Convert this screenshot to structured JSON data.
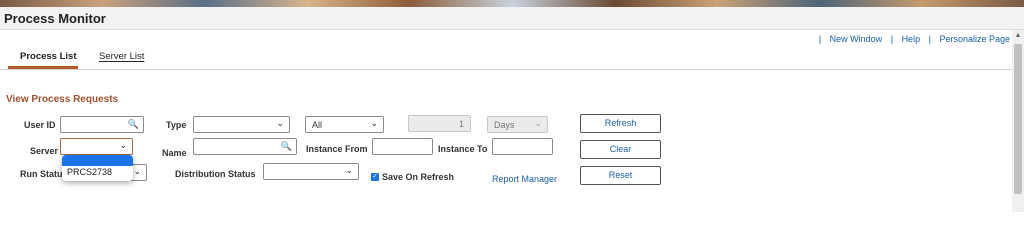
{
  "header": {
    "title": "Process Monitor"
  },
  "toplinks": {
    "new_window": "New Window",
    "help": "Help",
    "personalize": "Personalize Page"
  },
  "tabs": [
    {
      "label": "Process List",
      "active": true
    },
    {
      "label": "Server List",
      "active": false
    }
  ],
  "section_title": "View Process Requests",
  "form": {
    "user_id_label": "User ID",
    "user_id_value": "",
    "type_label": "Type",
    "type_value": "",
    "last_value": "All",
    "number_value": "1",
    "unit_value": "Days",
    "server_label": "Server",
    "server_value": "",
    "name_label": "Name",
    "name_value": "",
    "instance_from_label": "Instance From",
    "instance_from_value": "",
    "instance_to_label": "Instance To",
    "instance_to_value": "",
    "run_status_label": "Run Status",
    "distribution_status_label": "Distribution Status",
    "distribution_status_value": "",
    "save_on_refresh_label": "Save On Refresh",
    "save_on_refresh_checked": true
  },
  "buttons": {
    "refresh": "Refresh",
    "clear": "Clear",
    "reset": "Reset"
  },
  "links": {
    "report_manager": "Report Manager"
  },
  "server_dropdown": {
    "options": [
      "",
      "PRCS2738"
    ],
    "highlighted": ""
  },
  "colors": {
    "accent": "#a0522d",
    "link": "#1a5fa8",
    "highlight": "#1a73e8"
  }
}
